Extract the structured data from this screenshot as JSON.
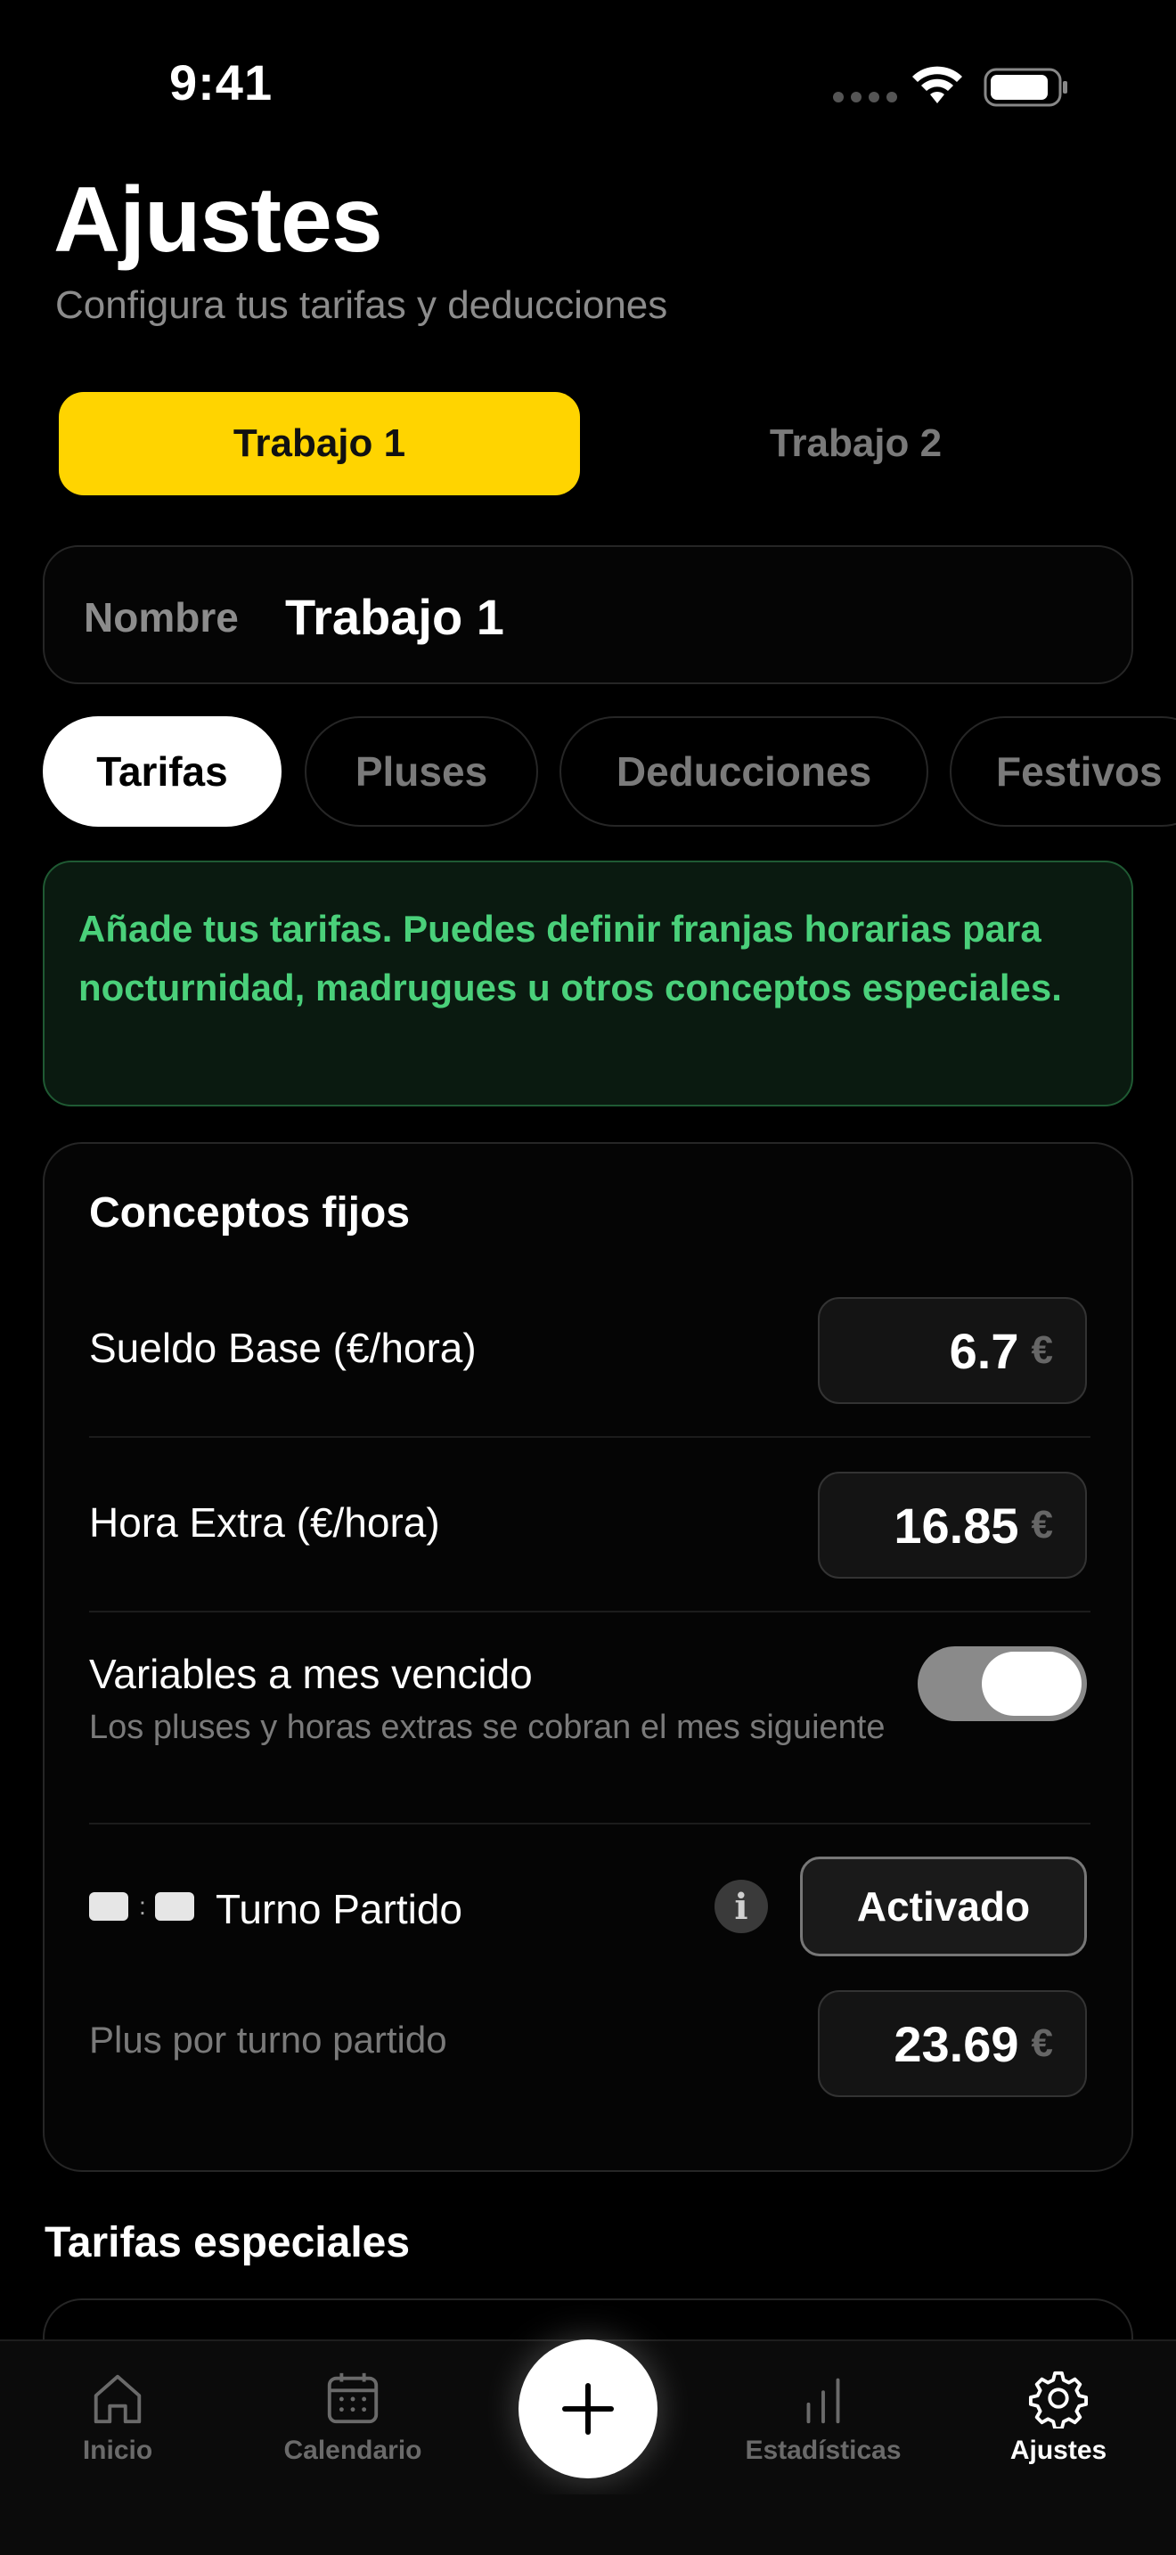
{
  "status": {
    "time": "9:41"
  },
  "header": {
    "title": "Ajustes",
    "subtitle": "Configura tus tarifas y deducciones"
  },
  "jobs": [
    {
      "label": "Trabajo 1",
      "active": true
    },
    {
      "label": "Trabajo 2",
      "active": false
    }
  ],
  "name_field": {
    "label": "Nombre",
    "value": "Trabajo 1"
  },
  "sections": [
    {
      "label": "Tarifas",
      "active": true
    },
    {
      "label": "Pluses",
      "active": false
    },
    {
      "label": "Deducciones",
      "active": false
    },
    {
      "label": "Festivos",
      "active": false
    }
  ],
  "info_banner": "Añade tus tarifas. Puedes definir franjas horarias para nocturnidad, madrugues u otros conceptos especiales.",
  "fixed_concepts": {
    "title": "Conceptos fijos",
    "base_salary": {
      "label": "Sueldo Base (€/hora)",
      "value": "6.7",
      "unit": "€"
    },
    "overtime": {
      "label": "Hora Extra (€/hora)",
      "value": "16.85",
      "unit": "€"
    },
    "deferred": {
      "label": "Variables a mes vencido",
      "description": "Los pluses y horas extras se cobran el mes siguiente",
      "enabled": true
    },
    "split_shift": {
      "label": "Turno Partido",
      "info_icon": "i",
      "status": "Activado",
      "plus_label": "Plus por turno partido",
      "plus_value": "23.69",
      "plus_unit": "€"
    }
  },
  "special_rates": {
    "title": "Tarifas especiales"
  },
  "tab_bar": {
    "items": [
      {
        "label": "Inicio",
        "icon": "home-icon",
        "active": false
      },
      {
        "label": "Calendario",
        "icon": "calendar-icon",
        "active": false
      },
      {
        "label": "Estadísticas",
        "icon": "stats-icon",
        "active": false
      },
      {
        "label": "Ajustes",
        "icon": "gear-icon",
        "active": true
      }
    ],
    "add_icon": "plus-icon"
  },
  "colors": {
    "accent": "#ffd400",
    "info_text": "#4ad07a",
    "background": "#000000"
  }
}
